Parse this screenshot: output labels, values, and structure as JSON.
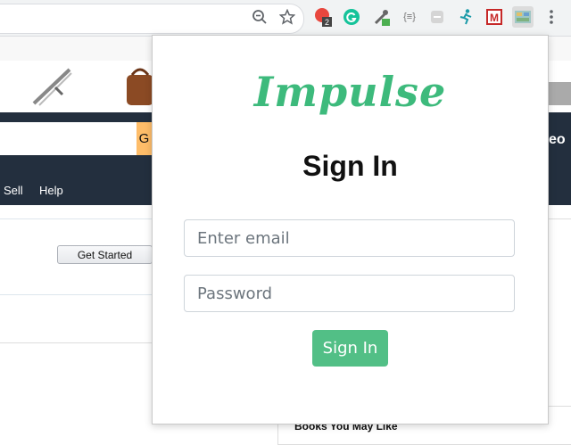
{
  "browser": {
    "toolbar": {
      "zoom_icon": "zoom-out-icon",
      "bookmark_icon": "star-icon",
      "extensions": [
        {
          "name": "red-extension-icon",
          "badge": "2"
        },
        {
          "name": "grammarly-icon"
        },
        {
          "name": "eyedropper-icon"
        },
        {
          "name": "json-viewer-icon",
          "label": "{≡}"
        },
        {
          "name": "gray-extension-icon"
        },
        {
          "name": "runner-icon"
        },
        {
          "name": "gmail-m-icon",
          "label": "M"
        },
        {
          "name": "impulse-extension-icon"
        }
      ],
      "menu_icon": "kebab-menu-icon"
    }
  },
  "background_page": {
    "nav_items": [
      "Sell",
      "Help"
    ],
    "search_button_text": "G",
    "header_right_text": "eo",
    "get_started_label": "Get Started",
    "books_title": "Books You May Like"
  },
  "popup": {
    "logo": "Impulse",
    "title": "Sign In",
    "email_placeholder": "Enter email",
    "password_placeholder": "Password",
    "submit_label": "Sign In",
    "accent_color": "#52bf86"
  }
}
